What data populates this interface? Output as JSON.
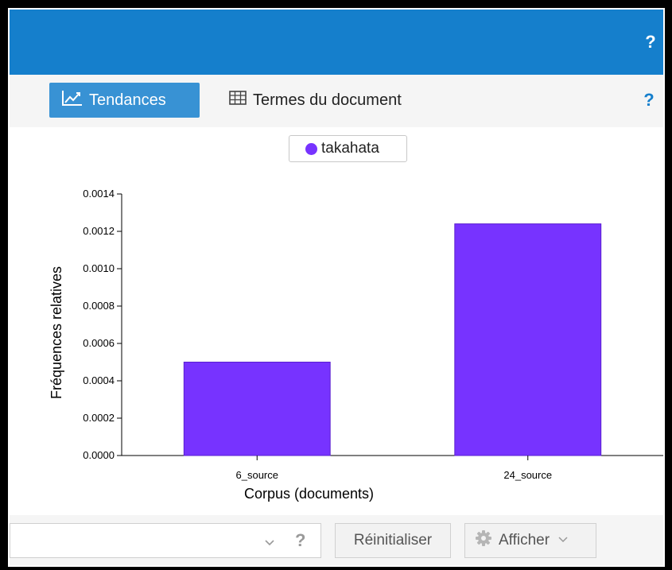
{
  "header": {
    "help": "?"
  },
  "tabs": [
    {
      "label": "Tendances",
      "icon": "line-chart-icon",
      "active": true
    },
    {
      "label": "Termes du document",
      "icon": "table-icon",
      "active": false
    }
  ],
  "tabbar_help": "?",
  "legend": {
    "label": "takahata",
    "color": "#7733ff"
  },
  "chart_data": {
    "type": "bar",
    "categories": [
      "6_source",
      "24_source"
    ],
    "series": [
      {
        "name": "takahata",
        "values": [
          0.0005,
          0.00124
        ],
        "color": "#7733ff"
      }
    ],
    "xlabel": "Corpus (documents)",
    "ylabel": "Fréquences relatives",
    "ylim": [
      0,
      0.0014
    ],
    "yticks": [
      "0.0000",
      "0.0002",
      "0.0004",
      "0.0006",
      "0.0008",
      "0.0010",
      "0.0012",
      "0.0014"
    ],
    "grid": false
  },
  "bottom": {
    "combo_value": "",
    "combo_help": "?",
    "reset_label": "Réinitialiser",
    "show_label": "Afficher"
  },
  "colors": {
    "header": "#157fcc",
    "tab_active": "#3892d4",
    "bar": "#7733ff"
  }
}
